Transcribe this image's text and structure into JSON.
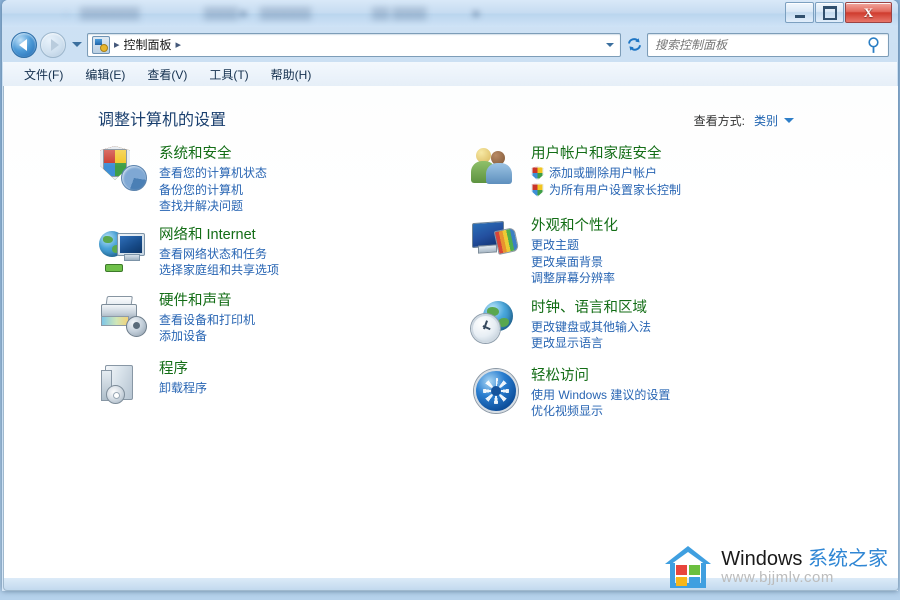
{
  "window": {
    "titlebar_blurred_segments": [
      "·",
      "▒▒▒▒▒▒▒",
      "▒▒▒▒ ▸",
      "▒▒▒▒▒▒",
      "▒▒ ▒▒▒▒",
      "▸"
    ],
    "controls": {
      "minimize": "minimize",
      "maximize": "maximize",
      "close": "X"
    }
  },
  "navbar": {
    "back": "后退",
    "forward": "前进",
    "history_dropdown": "最近访问的位置",
    "breadcrumb": {
      "icon": "control-panel-icon",
      "items": [
        "控制面板"
      ],
      "separator": "▸"
    },
    "address_dropdown": "▾",
    "refresh": "↻"
  },
  "search": {
    "placeholder": "搜索控制面板",
    "value": "",
    "icon": "search-icon"
  },
  "menubar": {
    "items": [
      {
        "label": "文件(F)"
      },
      {
        "label": "编辑(E)"
      },
      {
        "label": "查看(V)"
      },
      {
        "label": "工具(T)"
      },
      {
        "label": "帮助(H)"
      }
    ]
  },
  "main": {
    "page_title": "调整计算机的设置",
    "view_by": {
      "label": "查看方式:",
      "value": "类别",
      "caret": "▾"
    },
    "left_column": [
      {
        "icon": "security-shield-icon",
        "title": "系统和安全",
        "links": [
          {
            "label": "查看您的计算机状态",
            "shield": false
          },
          {
            "label": "备份您的计算机",
            "shield": false
          },
          {
            "label": "查找并解决问题",
            "shield": false
          }
        ]
      },
      {
        "icon": "network-globe-icon",
        "title": "网络和 Internet",
        "links": [
          {
            "label": "查看网络状态和任务",
            "shield": false
          },
          {
            "label": "选择家庭组和共享选项",
            "shield": false
          }
        ]
      },
      {
        "icon": "printer-sound-icon",
        "title": "硬件和声音",
        "links": [
          {
            "label": "查看设备和打印机",
            "shield": false
          },
          {
            "label": "添加设备",
            "shield": false
          }
        ]
      },
      {
        "icon": "programs-box-icon",
        "title": "程序",
        "links": [
          {
            "label": "卸载程序",
            "shield": false
          }
        ]
      }
    ],
    "right_column": [
      {
        "icon": "user-accounts-icon",
        "title": "用户帐户和家庭安全",
        "links": [
          {
            "label": "添加或删除用户帐户",
            "shield": true
          },
          {
            "label": "为所有用户设置家长控制",
            "shield": true
          }
        ]
      },
      {
        "icon": "appearance-display-icon",
        "title": "外观和个性化",
        "links": [
          {
            "label": "更改主题",
            "shield": false
          },
          {
            "label": "更改桌面背景",
            "shield": false
          },
          {
            "label": "调整屏幕分辨率",
            "shield": false
          }
        ]
      },
      {
        "icon": "clock-language-icon",
        "title": "时钟、语言和区域",
        "links": [
          {
            "label": "更改键盘或其他输入法",
            "shield": false
          },
          {
            "label": "更改显示语言",
            "shield": false
          }
        ]
      },
      {
        "icon": "ease-of-access-icon",
        "title": "轻松访问",
        "links": [
          {
            "label": "使用 Windows 建议的设置",
            "shield": false
          },
          {
            "label": "优化视频显示",
            "shield": false
          }
        ]
      }
    ]
  },
  "watermark": {
    "brand_en": "Windows",
    "brand_cn": "系统之家",
    "url": "www.bjjmlv.com",
    "logo": "windows-house-logo"
  },
  "colors": {
    "category_title": "#136d16",
    "link": "#2865b3",
    "page_title": "#1a3f6e",
    "accent_blue": "#2f86d4",
    "close_button": "#cf3c2e"
  }
}
